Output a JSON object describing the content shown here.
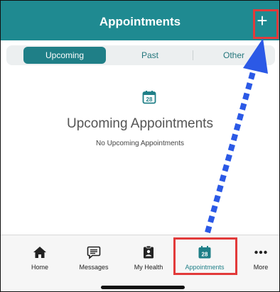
{
  "header": {
    "title": "Appointments",
    "add_label": "+",
    "color": "#1f8a91"
  },
  "segments": {
    "items": [
      {
        "label": "Upcoming",
        "selected": true
      },
      {
        "label": "Past",
        "selected": false
      },
      {
        "label": "Other",
        "selected": false
      }
    ]
  },
  "empty_state": {
    "icon": "calendar-icon",
    "icon_day": "28",
    "title": "Upcoming Appointments",
    "subtitle": "No Upcoming Appointments"
  },
  "tabbar": {
    "items": [
      {
        "label": "Home",
        "icon": "home-icon",
        "active": false
      },
      {
        "label": "Messages",
        "icon": "messages-icon",
        "active": false
      },
      {
        "label": "My Health",
        "icon": "clipboard-icon",
        "active": false
      },
      {
        "label": "Appointments",
        "icon": "calendar-icon",
        "day": "28",
        "active": true
      },
      {
        "label": "More",
        "icon": "more-icon",
        "active": false
      }
    ]
  },
  "annotations": {
    "highlight_color": "#e23a3a",
    "arrow_color": "#2b59e6"
  }
}
